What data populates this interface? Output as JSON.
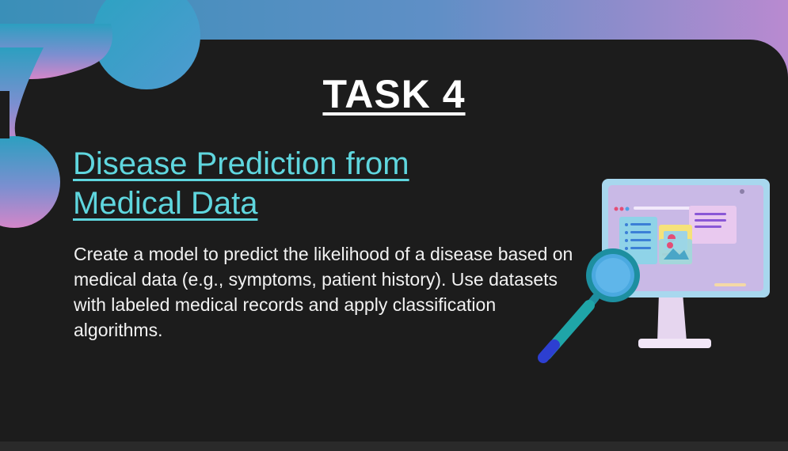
{
  "slide": {
    "title": "TASK 4",
    "subtitle_line1": "Disease Prediction from",
    "subtitle_line2": "Medical Data",
    "description": "Create a model to predict the likelihood of a disease based on medical data (e.g., symptoms, patient history). Use datasets with labeled medical records and apply classification algorithms."
  },
  "colors": {
    "background": "#1c1c1c",
    "title": "#ffffff",
    "subtitle": "#5fd6de",
    "body_text": "#f2f2f2",
    "banner_left": "#3a8fb8",
    "banner_right": "#b98ad0"
  },
  "illustration": {
    "icon": "monitor-with-magnifying-glass-icon"
  }
}
